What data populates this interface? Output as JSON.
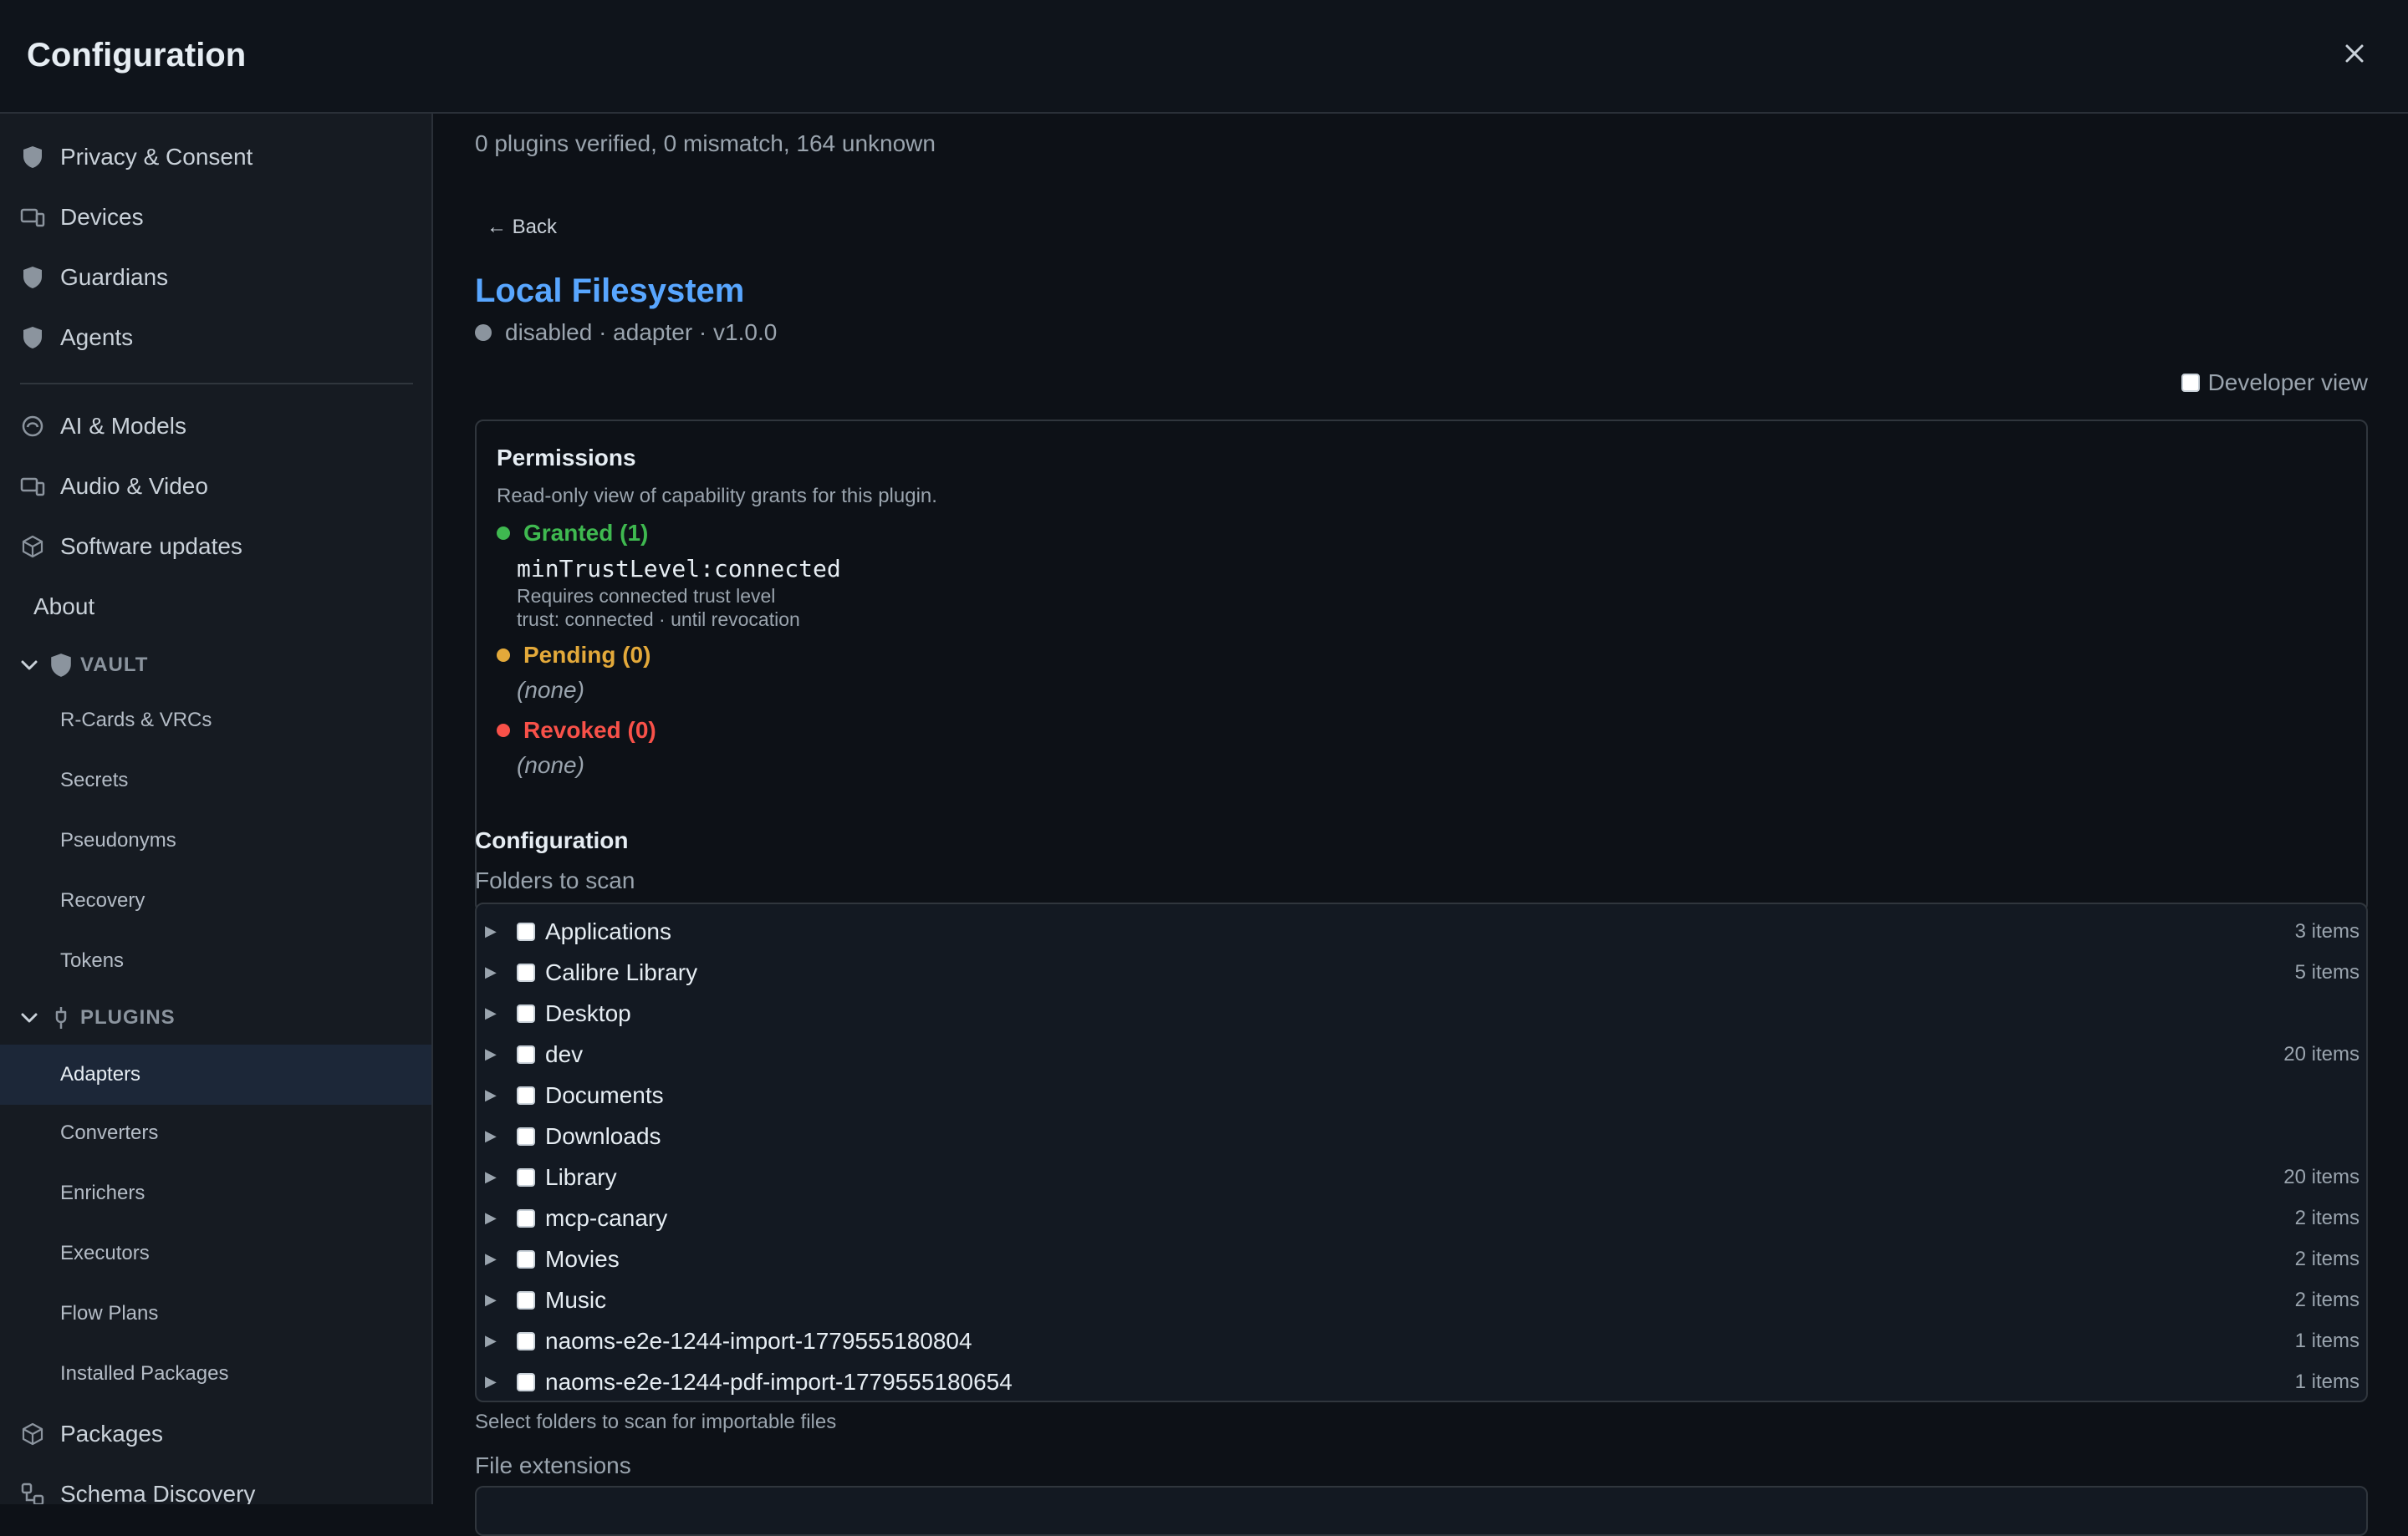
{
  "window": {
    "title": "Configuration"
  },
  "sidebar": {
    "top_items": [
      {
        "label": "Privacy & Consent",
        "icon": "shield-icon"
      },
      {
        "label": "Devices",
        "icon": "devices-icon"
      },
      {
        "label": "Guardians",
        "icon": "shield-icon"
      },
      {
        "label": "Agents",
        "icon": "shield-icon"
      }
    ],
    "mid_items": [
      {
        "label": "AI & Models",
        "icon": "ai-icon"
      },
      {
        "label": "Audio & Video",
        "icon": "devices-icon"
      },
      {
        "label": "Software updates",
        "icon": "box-icon"
      }
    ],
    "about": "About",
    "vault": {
      "label": "VAULT",
      "items": [
        "R-Cards & VRCs",
        "Secrets",
        "Pseudonyms",
        "Recovery",
        "Tokens"
      ]
    },
    "plugins": {
      "label": "PLUGINS",
      "items": [
        "Adapters",
        "Converters",
        "Enrichers",
        "Executors",
        "Flow Plans",
        "Installed Packages"
      ],
      "active": "Adapters"
    },
    "bottom_items": [
      {
        "label": "Packages",
        "icon": "box-icon"
      },
      {
        "label": "Schema Discovery",
        "icon": "schema-icon"
      }
    ]
  },
  "main": {
    "summary": "0 plugins verified, 0 mismatch, 164 unknown",
    "back_label": "← Back",
    "plugin": {
      "name": "Local Filesystem",
      "meta": "disabled · adapter · v1.0.0"
    },
    "developer_view_label": "Developer view",
    "permissions": {
      "title": "Permissions",
      "subtitle": "Read-only view of capability grants for this plugin.",
      "granted_label": "Granted (1)",
      "granted_color": "#3fb950",
      "grant": {
        "name": "minTrustLevel:connected",
        "description": "Requires connected trust level",
        "trust": "trust: connected · until revocation"
      },
      "pending_label": "Pending (0)",
      "pending_color": "#e3a93a",
      "pending_none": "(none)",
      "revoked_label": "Revoked (0)",
      "revoked_color": "#f85149",
      "revoked_none": "(none)"
    },
    "configuration": {
      "title": "Configuration",
      "folders_label": "Folders to scan",
      "folders": [
        {
          "name": "Applications",
          "count": "3 items"
        },
        {
          "name": "Calibre Library",
          "count": "5 items"
        },
        {
          "name": "Desktop",
          "count": ""
        },
        {
          "name": "dev",
          "count": "20 items"
        },
        {
          "name": "Documents",
          "count": ""
        },
        {
          "name": "Downloads",
          "count": ""
        },
        {
          "name": "Library",
          "count": "20 items"
        },
        {
          "name": "mcp-canary",
          "count": "2 items"
        },
        {
          "name": "Movies",
          "count": "2 items"
        },
        {
          "name": "Music",
          "count": "2 items"
        },
        {
          "name": "naoms-e2e-1244-import-1779555180804",
          "count": "1 items"
        },
        {
          "name": "naoms-e2e-1244-pdf-import-1779555180654",
          "count": "1 items"
        }
      ],
      "folders_help": "Select folders to scan for importable files",
      "extensions_label": "File extensions"
    }
  }
}
